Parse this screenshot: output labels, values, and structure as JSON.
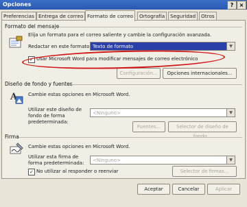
{
  "window": {
    "title": "Opciones",
    "help_btn": "?",
    "close_btn": "×"
  },
  "tabs": [
    {
      "label": "Preferencias"
    },
    {
      "label": "Entrega de correo"
    },
    {
      "label": "Formato de correo"
    },
    {
      "label": "Ortografía"
    },
    {
      "label": "Seguridad"
    },
    {
      "label": "Otros"
    }
  ],
  "format": {
    "section": "Formato del mensaje",
    "desc": "Elija un formato para el correo saliente y cambie la configuración avanzada.",
    "redactar_label": "Redactar en este formato:",
    "redactar_value": "Texto de formato",
    "word_checkbox_label": "Usar Microsoft Word para modificar mensajes de correo electrónico",
    "config_button": "Configuración...",
    "intl_button": "Opciones internacionales..."
  },
  "background": {
    "section": "Diseño de fondo y fuentes",
    "desc": "Cambie estas opciones en Microsoft Word.",
    "label": "Utilizar este diseño de fondo de forma predeterminada:",
    "value": "<Ninguno>",
    "fonts_button": "Fuentes...",
    "selector_button": "Selector de diseño de fondo..."
  },
  "signature": {
    "section": "Firma",
    "desc": "Cambie estas opciones en Microsoft Word.",
    "label": "Utilizar esta firma de forma predeterminada:",
    "value": "<Ninguno>",
    "noreply_label": "No utilizar al responder o reenviar",
    "selector_button": "Selector de firmas..."
  },
  "footer": {
    "ok": "Aceptar",
    "cancel": "Cancelar",
    "apply": "Aplicar"
  }
}
